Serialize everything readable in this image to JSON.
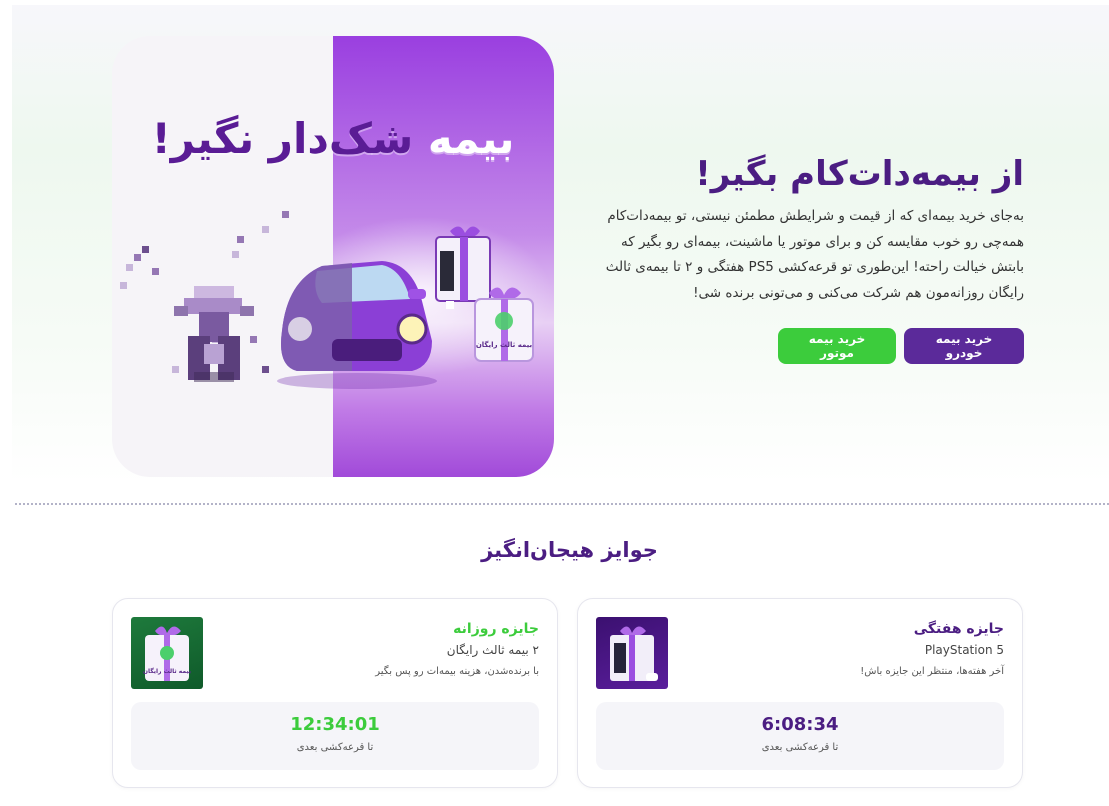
{
  "hero": {
    "slogan_dark": "شک‌دار نگیر!",
    "slogan_light": "بیمه",
    "title": "از بیمه‌دات‌کام بگیر!",
    "description": "به‌جای خرید بیمه‌ای که از قیمت و شرایطش مطمئن نیستی، تو بیمه‌دات‌کام همه‌چی رو خوب مقایسه کن و برای موتور یا ماشینت، بیمه‌ای رو بگیر که بابتش خیالت راحته! این‌طوری تو قرعه‌کشی PS5 هفتگی و ۲ تا بیمه‌ی ثالث رایگان روزانه‌مون هم شرکت می‌کنی و می‌تونی برنده شی!",
    "buy_car_label": "خرید بیمه خودرو",
    "buy_motor_label": "خرید بیمه موتور",
    "gift_tag_text": "بیمه ثالث رایگان"
  },
  "prizes": {
    "section_title": "جوایز هیجان‌انگیز",
    "weekly": {
      "name": "جایزه هفتگی",
      "item": "PlayStation 5",
      "note": "آخر هفته‌ها، منتظر این جایزه باش!",
      "countdown": "6:08:34",
      "countdown_label": "تا قرعه‌کشی بعدی"
    },
    "daily": {
      "name": "جایزه روزانه",
      "item": "۲ بیمه ثالث رایگان",
      "note": "با برنده‌شدن، هزینه بیمه‌ات رو پس بگیر",
      "countdown": "12:34:01",
      "countdown_label": "تا قرعه‌کشی بعدی",
      "gift_tag_text": "بیمه ثالث رایگان"
    }
  },
  "colors": {
    "brand_purple": "#4b1d82",
    "brand_green": "#3ccc3c"
  }
}
